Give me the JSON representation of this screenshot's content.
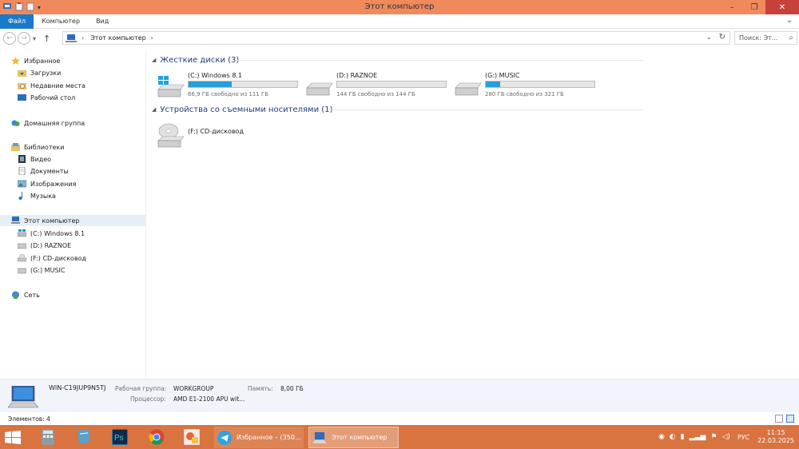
{
  "window": {
    "title": "Этот компьютер"
  },
  "ribbon": {
    "tabs": [
      "Файл",
      "Компьютер",
      "Вид"
    ]
  },
  "address": {
    "crumb": "Этот компьютер",
    "search_placeholder": "Поиск: Эт..."
  },
  "nav": {
    "favorites": "Избранное",
    "downloads": "Загрузки",
    "recent": "Недавние места",
    "desktop": "Рабочий стол",
    "homegroup": "Домашняя группа",
    "libraries": "Библиотеки",
    "video": "Видео",
    "documents": "Документы",
    "images": "Изображения",
    "music": "Музыка",
    "this_pc": "Этот компьютер",
    "drive_c": "(C:) Windows 8.1",
    "drive_d": "(D:) RAZNOE",
    "drive_f": "(F:) CD-дисковод",
    "drive_g": "(G:) MUSIC",
    "network": "Сеть"
  },
  "content": {
    "hard_disks_header": "Жесткие диски (3)",
    "removable_header": "Устройства со съемными носителями (1)",
    "drives": [
      {
        "name": "(C:) Windows 8.1",
        "free": "66,9 ГБ свободно из 111 ГБ",
        "used_fraction": 0.4
      },
      {
        "name": "(D:) RAZNOE",
        "free": "144 ГБ свободно из 144 ГБ",
        "used_fraction": 0.0
      },
      {
        "name": "(G:) MUSIC",
        "free": "280 ГБ свободно из 321 ГБ",
        "used_fraction": 0.13
      }
    ],
    "cd_drive": "(F:) CD-дисковод"
  },
  "details": {
    "computer_name": "WIN-C19JUP9N5TJ",
    "workgroup_label": "Рабочая группа:",
    "workgroup_value": "WORKGROUP",
    "memory_label": "Память:",
    "memory_value": "8,00 ГБ",
    "cpu_label": "Процессор:",
    "cpu_value": "AMD E1-2100 APU wit..."
  },
  "status": {
    "items": "Элементов: 4"
  },
  "taskbar": {
    "task1": "Избранное – (350...",
    "task2": "Этот компьютер",
    "lang": "РУС",
    "time": "11:15",
    "date": "22.03.2025"
  },
  "colors": {
    "titlebar": "#f08a5d",
    "taskbar": "#d9733f",
    "accent": "#1979ca",
    "progress": "#26a0da",
    "group_header": "#1e3d76"
  }
}
